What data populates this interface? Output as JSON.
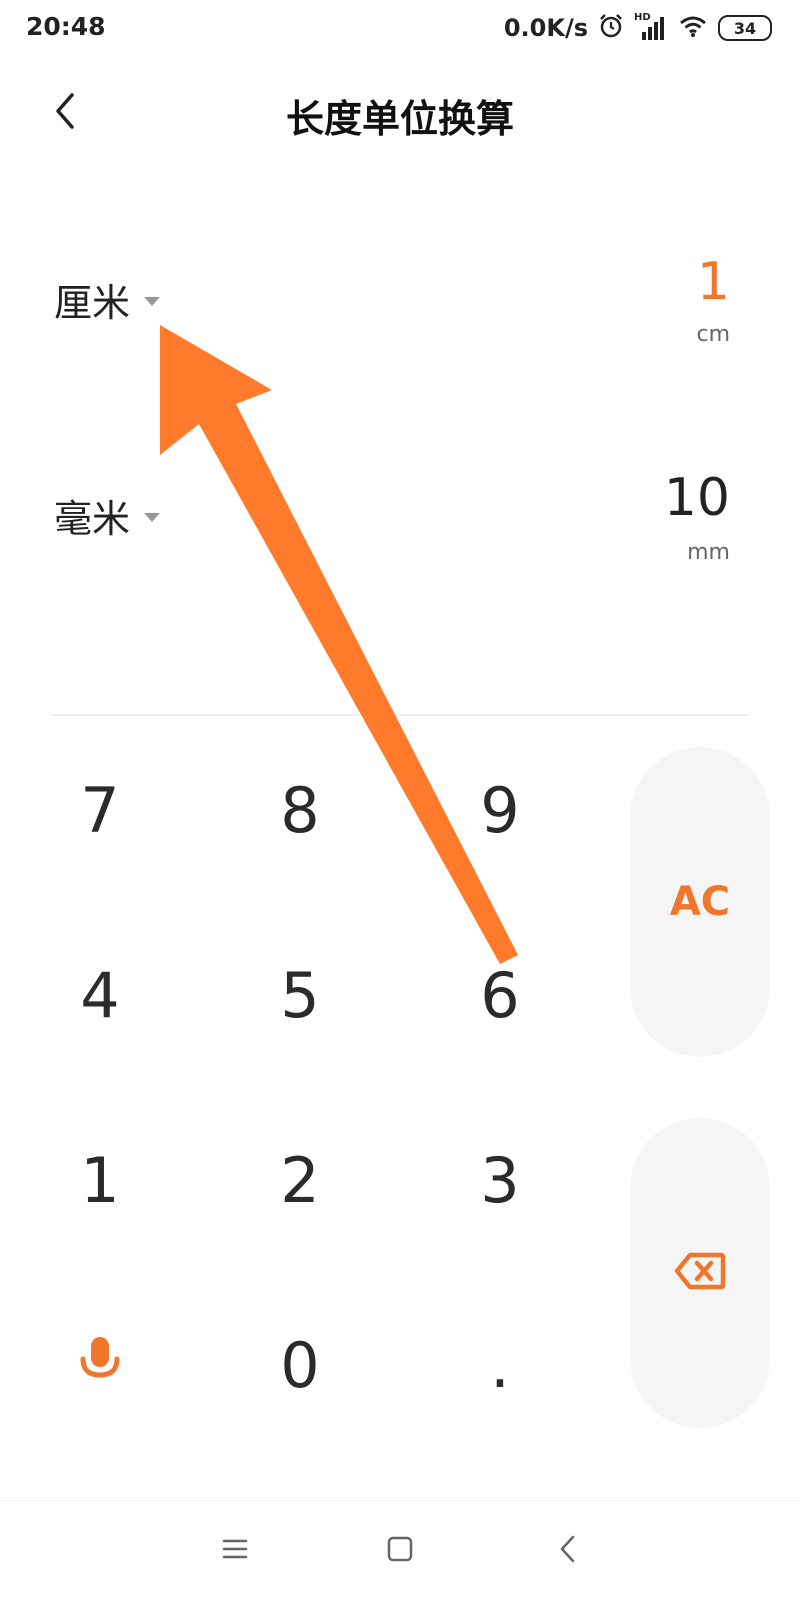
{
  "status_bar": {
    "time": "20:48",
    "net_speed": "0.0K/s",
    "network_badge": "HD",
    "battery": "34"
  },
  "header": {
    "title": "长度单位换算"
  },
  "converter": {
    "from": {
      "unit_name": "厘米",
      "value": "1",
      "unit_symbol": "cm"
    },
    "to": {
      "unit_name": "毫米",
      "value": "10",
      "unit_symbol": "mm"
    }
  },
  "keypad": {
    "keys": [
      "7",
      "8",
      "9",
      "4",
      "5",
      "6",
      "1",
      "2",
      "3",
      "0",
      "."
    ],
    "clear_label": "AC"
  },
  "icons": {
    "back": "back-chevron-icon",
    "alarm": "alarm-clock-icon",
    "signal": "signal-bars-icon",
    "wifi": "wifi-icon",
    "microphone": "microphone-icon",
    "backspace": "backspace-icon",
    "nav_menu": "menu-icon",
    "nav_home": "home-square-icon",
    "nav_back": "nav-back-icon"
  },
  "colors": {
    "accent": "#f0762c",
    "key_text": "#2b2b2b",
    "pill_bg": "#f5f5f5",
    "annotation_arrow": "#ff7a2a"
  }
}
